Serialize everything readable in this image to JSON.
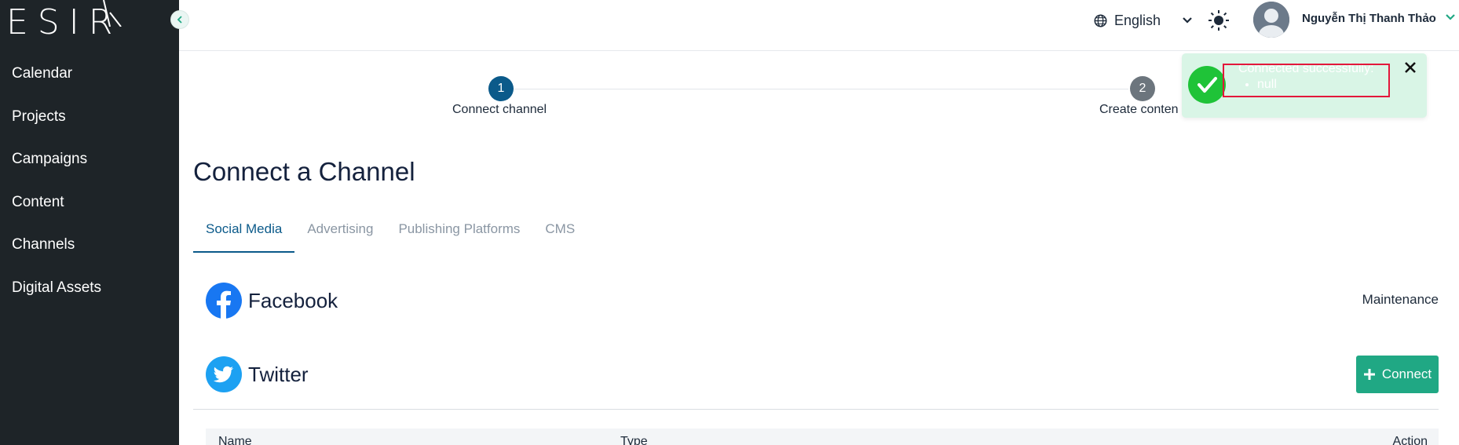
{
  "sidebar": {
    "logo": "ESIR",
    "items": [
      {
        "label": "Calendar"
      },
      {
        "label": "Projects"
      },
      {
        "label": "Campaigns"
      },
      {
        "label": "Content"
      },
      {
        "label": "Channels"
      },
      {
        "label": "Digital Assets"
      }
    ]
  },
  "header": {
    "language": "English",
    "user_name": "Nguyễn Thị Thanh Thảo"
  },
  "stepper": {
    "steps": [
      {
        "number": "1",
        "label": "Connect channel",
        "state": "active"
      },
      {
        "number": "2",
        "label": "Create conten",
        "state": "inactive"
      }
    ]
  },
  "page": {
    "title": "Connect a Channel"
  },
  "tabs": [
    {
      "label": "Social Media",
      "active": true
    },
    {
      "label": "Advertising",
      "active": false
    },
    {
      "label": "Publishing Platforms",
      "active": false
    },
    {
      "label": "CMS",
      "active": false
    }
  ],
  "channels": [
    {
      "name": "Facebook",
      "icon": "facebook-icon",
      "status": "Maintenance"
    },
    {
      "name": "Twitter",
      "icon": "twitter-icon",
      "action_label": "Connect"
    }
  ],
  "table": {
    "columns": [
      "Name",
      "Type",
      "Action"
    ]
  },
  "toast": {
    "message": "Connected successfully:",
    "items": [
      "null"
    ]
  },
  "colors": {
    "sidebar_bg": "#1e2428",
    "accent": "#0b5a8a",
    "connect_button": "#20a884",
    "toast_bg": "#d9f5e6",
    "toast_icon": "#1fc338",
    "highlight_border": "#e3173b"
  }
}
